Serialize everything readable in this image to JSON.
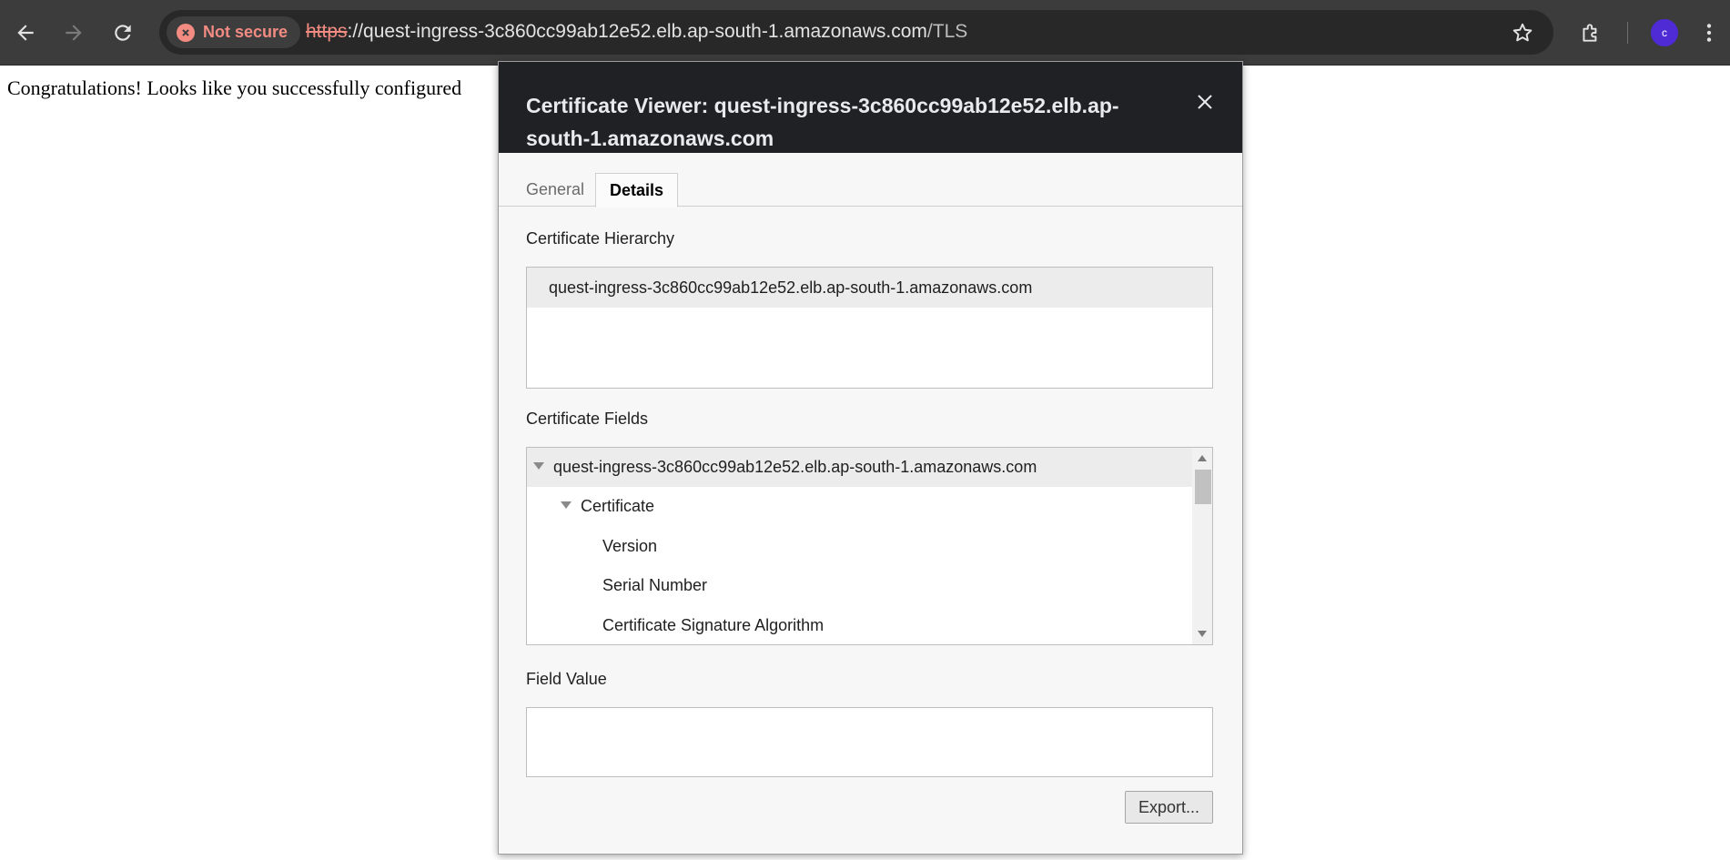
{
  "browser": {
    "security_chip": "Not secure",
    "url_scheme": "https",
    "url_host": "://quest-ingress-3c860cc99ab12e52.elb.ap-south-1.amazonaws.com",
    "url_path": "/TLS",
    "avatar_letter": "c",
    "colors": {
      "toolbar": "#3c3c3c",
      "warning": "#f28b82",
      "avatar": "#4f2bd6"
    }
  },
  "page": {
    "body_text": "Congratulations! Looks like you successfully configured"
  },
  "dialog": {
    "title": "Certificate Viewer: quest-ingress-3c860cc99ab12e52.elb.ap-south-1.amazonaws.com",
    "tabs": [
      {
        "label": "General",
        "active": false
      },
      {
        "label": "Details",
        "active": true
      }
    ],
    "hierarchy_label": "Certificate Hierarchy",
    "hierarchy_items": [
      "quest-ingress-3c860cc99ab12e52.elb.ap-south-1.amazonaws.com"
    ],
    "fields_label": "Certificate Fields",
    "fields": [
      {
        "label": "quest-ingress-3c860cc99ab12e52.elb.ap-south-1.amazonaws.com",
        "expanded": true
      },
      {
        "label": "Certificate",
        "expanded": true
      },
      {
        "label": "Version"
      },
      {
        "label": "Serial Number"
      },
      {
        "label": "Certificate Signature Algorithm"
      }
    ],
    "field_value_label": "Field Value",
    "field_value": "",
    "export_label": "Export..."
  }
}
